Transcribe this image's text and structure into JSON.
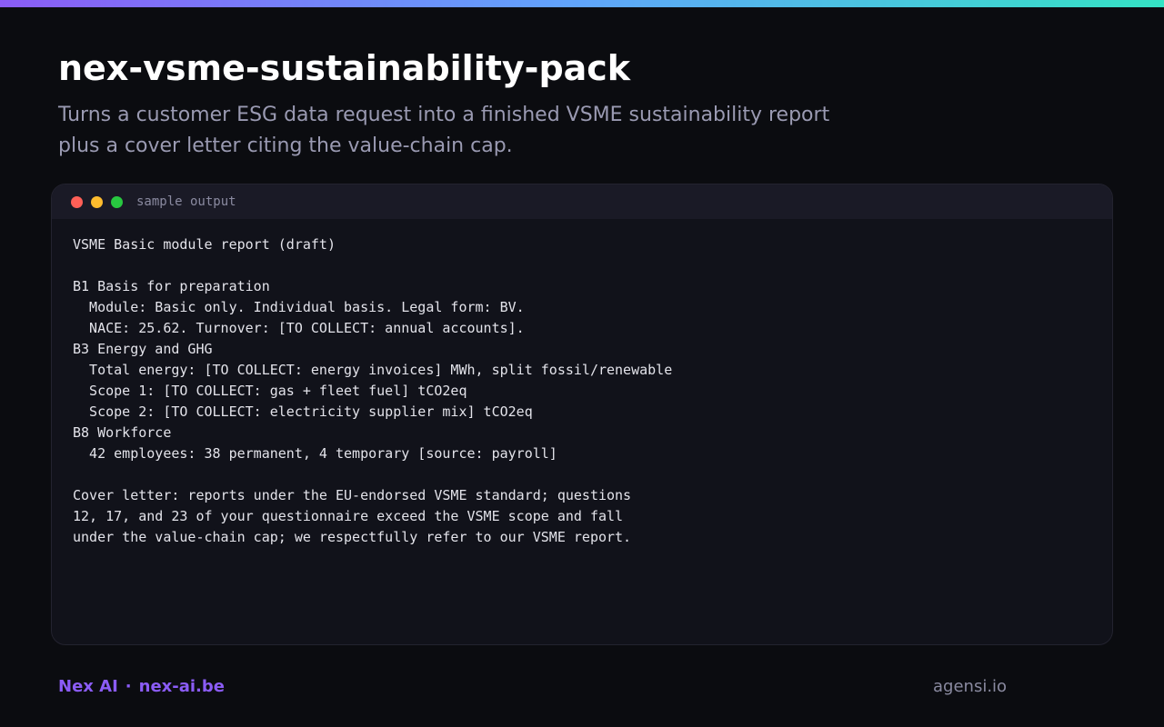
{
  "header": {
    "title": "nex-vsme-sustainability-pack",
    "subtitle": "Turns a customer ESG data request into a finished VSME sustainability report plus a cover letter citing the value-chain cap."
  },
  "colors": {
    "accent_gradient": [
      "#8b5cf6",
      "#60a5fa",
      "#34e3c4"
    ],
    "window_dot_red": "#ff5f57",
    "window_dot_yellow": "#febc2e",
    "window_dot_green": "#28c840",
    "brand": "#8b5cf6"
  },
  "panel": {
    "label": "sample output",
    "lines": [
      "VSME Basic module report (draft)",
      "",
      "B1 Basis for preparation",
      "  Module: Basic only. Individual basis. Legal form: BV.",
      "  NACE: 25.62. Turnover: [TO COLLECT: annual accounts].",
      "B3 Energy and GHG",
      "  Total energy: [TO COLLECT: energy invoices] MWh, split fossil/renewable",
      "  Scope 1: [TO COLLECT: gas + fleet fuel] tCO2eq",
      "  Scope 2: [TO COLLECT: electricity supplier mix] tCO2eq",
      "B8 Workforce",
      "  42 employees: 38 permanent, 4 temporary [source: payroll]",
      "",
      "Cover letter: reports under the EU-endorsed VSME standard; questions",
      "12, 17, and 23 of your questionnaire exceed the VSME scope and fall",
      "under the value-chain cap; we respectfully refer to our VSME report."
    ]
  },
  "footer": {
    "brand_name": "Nex AI",
    "separator": "·",
    "brand_site": "nex-ai.be",
    "domain": "agensi.io"
  }
}
